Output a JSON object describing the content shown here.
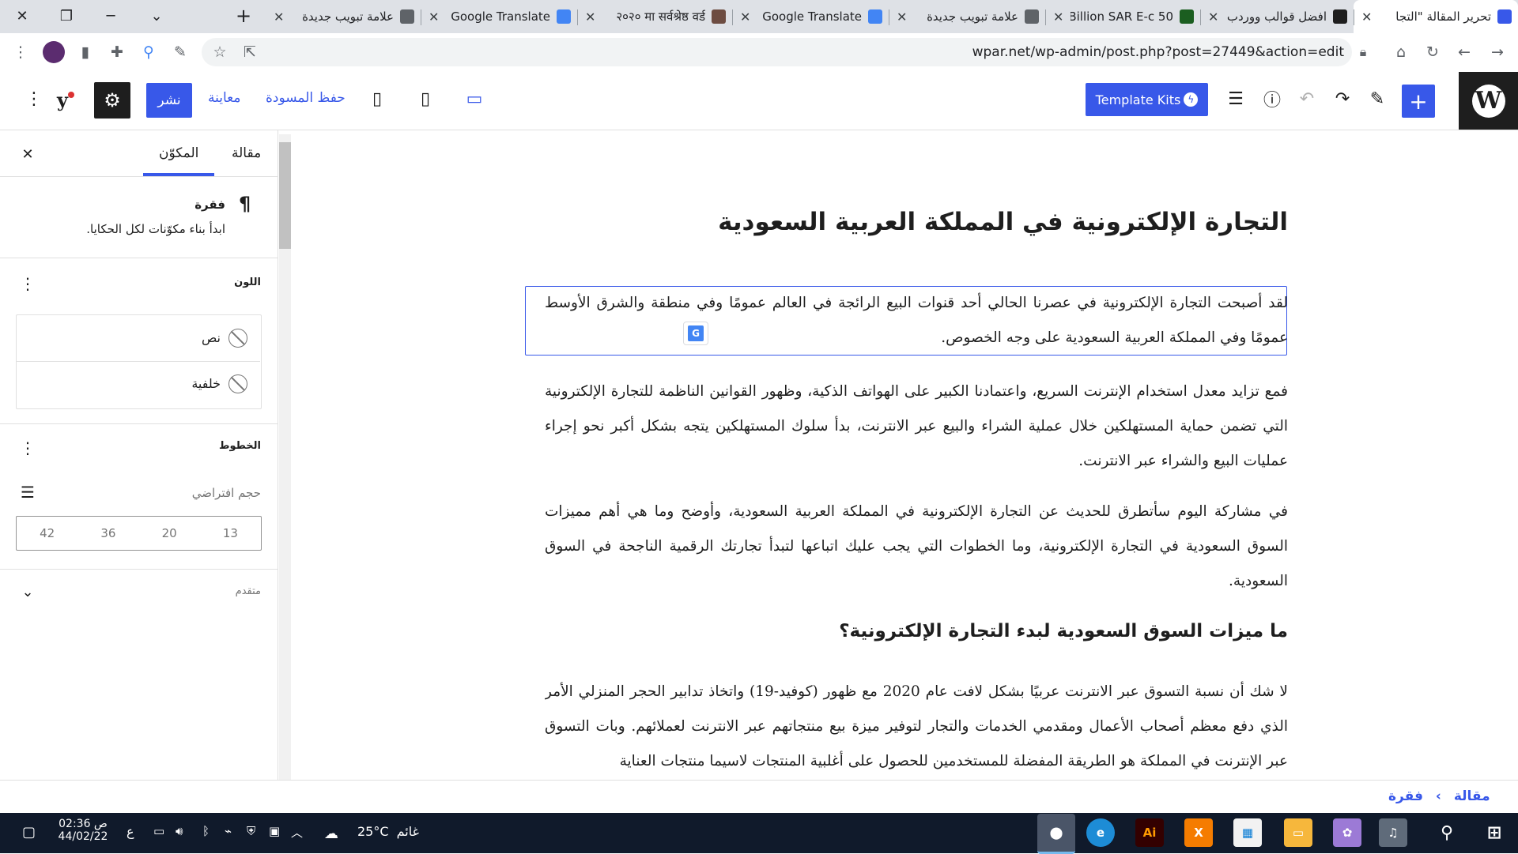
{
  "browser": {
    "tabs": [
      {
        "title": "تحرير المقالة \"التجا",
        "favicon": "wordpress-icon",
        "color": "#3858e9",
        "active": true
      },
      {
        "title": "افضل قوالب ووردب",
        "favicon": "trello-icon",
        "color": "#1e1e1e"
      },
      {
        "title": "50 Billion SAR E-c",
        "favicon": "ecc-icon",
        "color": "#1b5e20"
      },
      {
        "title": "علامة تبويب جديدة",
        "favicon": "chrome-icon",
        "color": "#5f6368"
      },
      {
        "title": "Google Translate",
        "favicon": "translate-icon",
        "color": "#4285f4"
      },
      {
        "title": "२०२० मा सर्वश्रेष्ठ वर्ड",
        "favicon": "feather-icon",
        "color": "#6d4c41"
      },
      {
        "title": "Google Translate",
        "favicon": "translate-icon",
        "color": "#4285f4"
      },
      {
        "title": "علامة تبويب جديدة",
        "favicon": "chrome-icon",
        "color": "#5f6368"
      }
    ],
    "url": "wpar.net/wp-admin/post.php?post=27449&action=edit"
  },
  "editor": {
    "header": {
      "template_kits": "Template Kits",
      "publish": "نشر",
      "preview": "معاينة",
      "save_draft": "حفظ المسودة"
    },
    "sidebar": {
      "tab_post": "مقالة",
      "tab_block": "المكوّن",
      "block_title": "فقرة",
      "block_description": "ابدأ بناء مكوّنات لكل الحكايا.",
      "color_section": "اللون",
      "color_text": "نص",
      "color_background": "خلفية",
      "typography_section": "الخطوط",
      "font_size_label": "حجم افتراضي",
      "font_sizes": [
        "13",
        "20",
        "36",
        "42"
      ],
      "advanced": "متقدم"
    },
    "content": {
      "title": "التجارة الإلكترونية في المملكة العربية السعودية",
      "p1": "لقد أصبحت التجارة الإلكترونية في عصرنا الحالي أحد قنوات البيع الرائجة في العالم عمومًا وفي منطقة والشرق الأوسط عمومًا وفي المملكة العربية السعودية على وجه الخصوص.",
      "p2": "فمع تزايد معدل استخدام الإنترنت السريع، واعتمادنا الكبير على الهواتف الذكية، وظهور القوانين الناظمة للتجارة الإلكترونية التي تضمن حماية المستهلكين خلال عملية الشراء والبيع عبر الانترنت، بدأ سلوك المستهلكين يتجه بشكل أكبر نحو إجراء عمليات البيع والشراء عبر الانترنت.",
      "p3": "في مشاركة اليوم سأتطرق للحديث عن التجارة الإلكترونية في المملكة العربية السعودية، وأوضح وما هي أهم مميزات السوق السعودية في التجارة الإلكترونية، وما الخطوات التي يجب عليك اتباعها لتبدأ تجارتك الرقمية الناجحة في السوق السعودية.",
      "h2": "ما ميزات السوق السعودية لبدء التجارة الإلكترونية؟",
      "p4": "لا شك أن نسبة التسوق عبر الانترنت عربيًا بشكل لافت عام 2020 مع ظهور (كوفيد-19) واتخاذ تدابير الحجر المنزلي الأمر الذي دفع معظم أصحاب الأعمال ومقدمي الخدمات والتجار لتوفير ميزة بيع منتجاتهم عبر الانترنت لعملائهم. وبات التسوق عبر الإنترنت في المملكة هو الطريقة المفضلة للمستخدمين للحصول على أغلبية المنتجات لاسيما منتجات العناية"
    },
    "breadcrumb": {
      "root": "مقالة",
      "separator": "›",
      "current": "فقرة"
    }
  },
  "taskbar": {
    "time": "02:36 ص",
    "date": "44/02/22",
    "weather": "25°C",
    "weather_text": "غائم",
    "lang": "ع"
  },
  "colors": {
    "accent": "#3858e9",
    "wp_dark": "#1e1e1e",
    "taskbar": "#101a2b"
  }
}
